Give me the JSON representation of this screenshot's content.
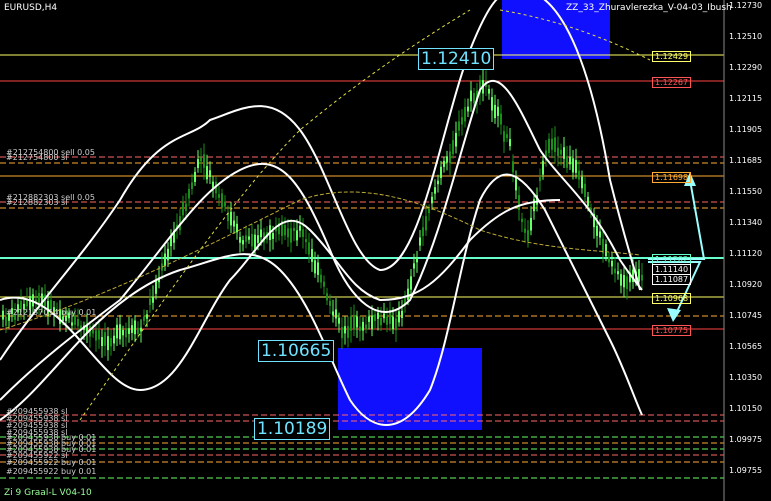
{
  "header": {
    "symbol": "EURUSD,H4",
    "indicator": "ZZ_33_Zhuravlerezka_V-04-03_Ibush"
  },
  "footer": {
    "indicator": "Zi 9 Graal-L V04-10"
  },
  "axis": {
    "ticks": [
      "1.12730",
      "1.12510",
      "1.12290",
      "1.12115",
      "1.11905",
      "1.11685",
      "1.11550",
      "1.11340",
      "1.11120",
      "1.10920",
      "1.10745",
      "1.10565",
      "1.10350",
      "1.10150",
      "1.09975",
      "1.09755"
    ]
  },
  "price_tags": [
    {
      "label": "1.12429",
      "color": "#ffff66"
    },
    {
      "label": "1.12267",
      "color": "#ff5555"
    },
    {
      "label": "1.11698",
      "color": "#ffaa33"
    },
    {
      "label": "1.11202",
      "color": "#66ffcc"
    },
    {
      "label": "1.11140",
      "color": "#ffffff"
    },
    {
      "label": "1.11087",
      "color": "#ffffff"
    },
    {
      "label": "1.10968",
      "color": "#ffff66"
    },
    {
      "label": "1.10775",
      "color": "#ff5555"
    }
  ],
  "big_labels": [
    "1.12410",
    "1.10665",
    "1.10189"
  ],
  "orders": [
    "#212754800 sell 0.05",
    "#212754800 sl",
    "#212882303 sell 0.05",
    "#212882303 sl",
    "#212157014 buy 0.01",
    "#209455938 sl",
    "#209455938 sl",
    "#209455938 sl",
    "#209455938 sl",
    "#209455938 buy 0.01",
    "#209455938 buy 0.01",
    "#209455938 buy 0.01",
    "#209455922 sl",
    "#209455922 buy 0.01",
    "#209455922 buy 0.01"
  ],
  "colors": {
    "bull": "#66ff66",
    "bear": "#1a8f1a",
    "band": "#ffffff",
    "zone": "#1010ff"
  }
}
